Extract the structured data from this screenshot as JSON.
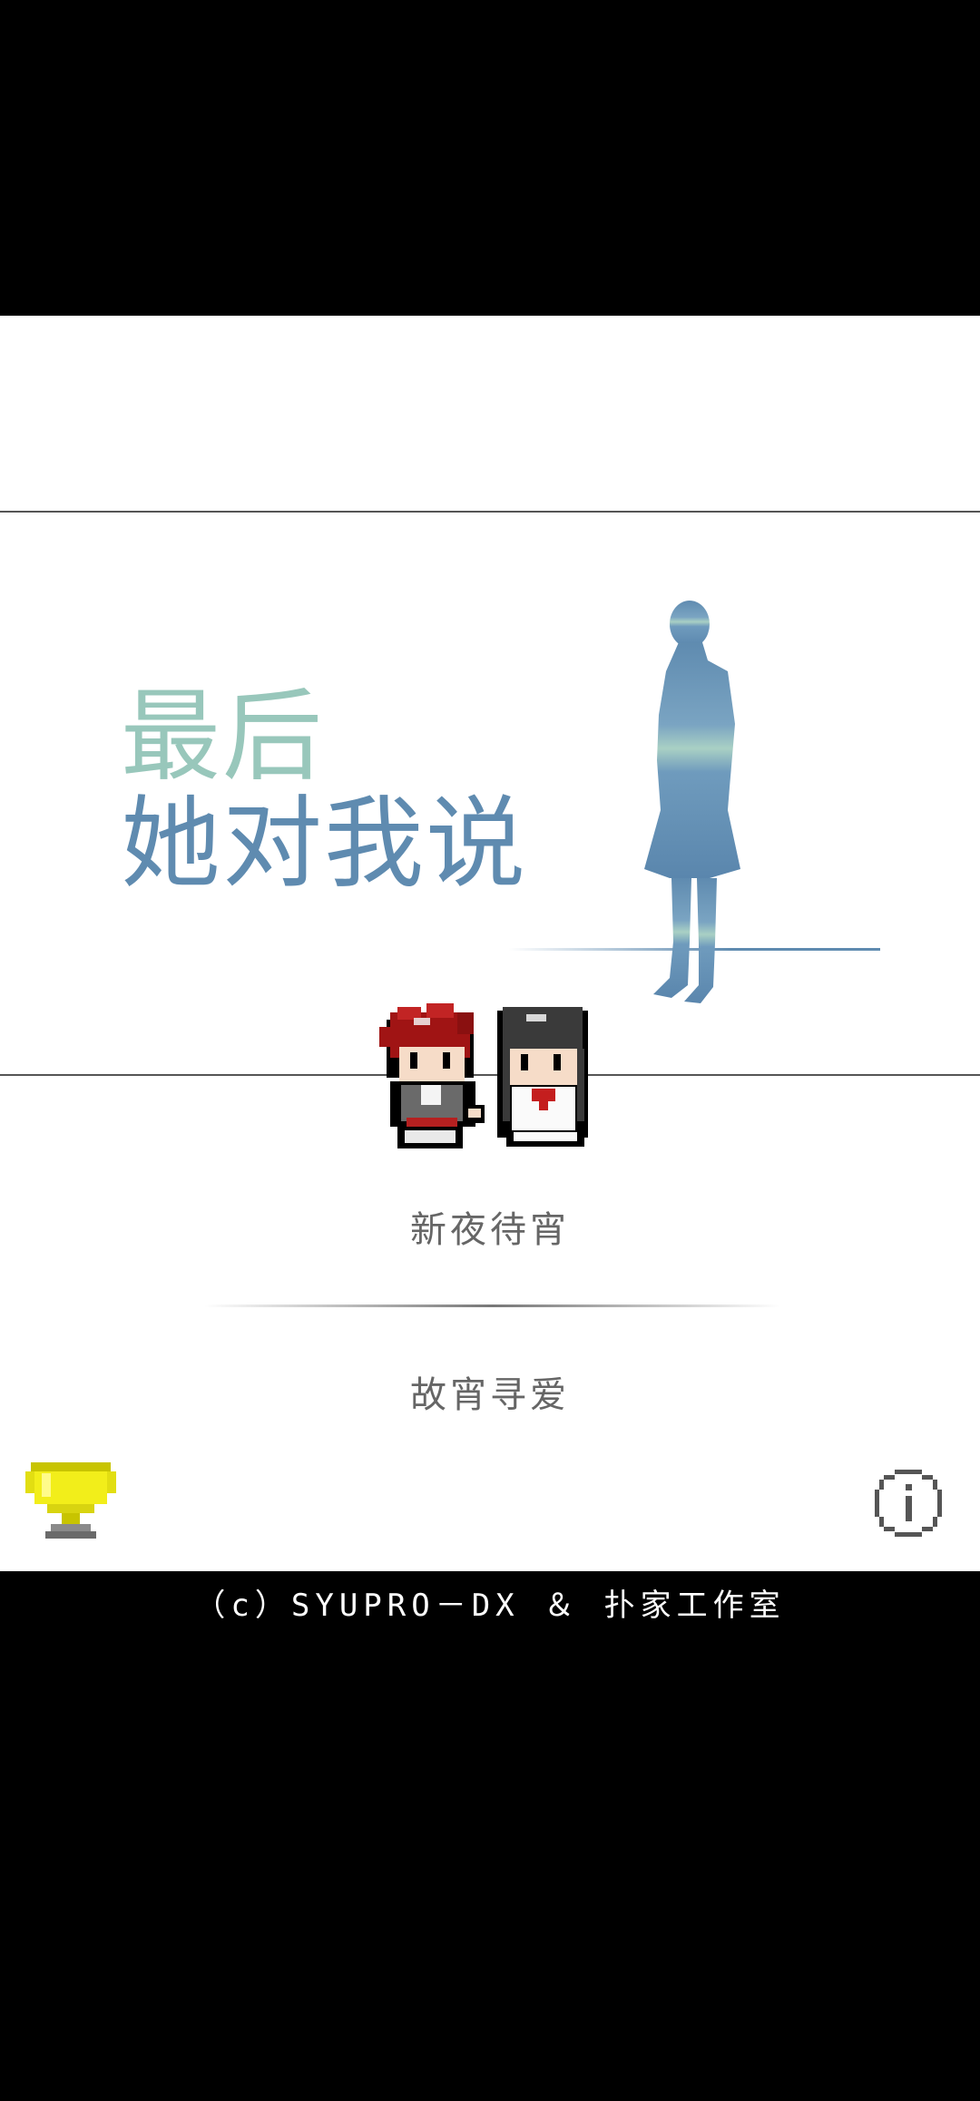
{
  "title": {
    "line1": "最后",
    "line2": "她对我说"
  },
  "menu": {
    "new_game": "新夜待宵",
    "continue": "故宵寻爱"
  },
  "footer": {
    "copyright": "（c）SYUPRO－DX ＆ 扑家工作室"
  },
  "icons": {
    "trophy": "trophy-icon",
    "info": "info-icon"
  },
  "colors": {
    "title_light": "#98c7bb",
    "title_dark": "#5f8bb0",
    "menu_text": "#666666",
    "trophy": "#f2ee1a"
  }
}
